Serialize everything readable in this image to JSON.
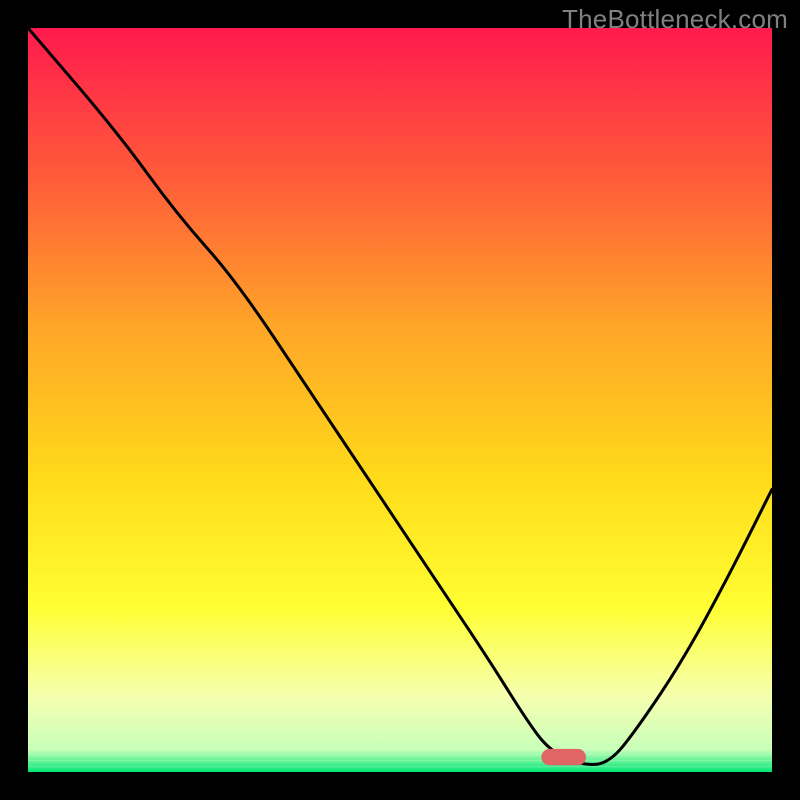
{
  "watermark": "TheBottleneck.com",
  "chart_data": {
    "type": "line",
    "title": "",
    "xlabel": "",
    "ylabel": "",
    "xlim": [
      0,
      100
    ],
    "ylim": [
      0,
      100
    ],
    "grid": false,
    "legend": false,
    "background": {
      "type": "vertical-gradient",
      "stops": [
        {
          "pos": 0.0,
          "color": "#ff1a4d"
        },
        {
          "pos": 0.2,
          "color": "#ff5b3a"
        },
        {
          "pos": 0.4,
          "color": "#ffa528"
        },
        {
          "pos": 0.6,
          "color": "#ffd91a"
        },
        {
          "pos": 0.78,
          "color": "#ffff33"
        },
        {
          "pos": 0.9,
          "color": "#f5ffb0"
        },
        {
          "pos": 0.97,
          "color": "#c7ffb8"
        },
        {
          "pos": 1.0,
          "color": "#00e676"
        }
      ]
    },
    "series": [
      {
        "name": "bottleneck-curve",
        "type": "line",
        "color": "#000000",
        "width": 3,
        "x": [
          0,
          12,
          20,
          28,
          38,
          48,
          56,
          62,
          67,
          70,
          74,
          78,
          82,
          88,
          94,
          100
        ],
        "values": [
          100,
          86,
          75,
          66,
          51,
          36,
          24,
          15,
          7,
          3,
          1,
          1,
          6,
          15,
          26,
          38
        ]
      }
    ],
    "marker": {
      "name": "optimal-point",
      "shape": "rounded-rect",
      "color": "#e06666",
      "x": 72,
      "y": 2,
      "w": 6,
      "h": 2.2
    },
    "axes": {
      "color": "#000000",
      "width": 28,
      "ticks": false
    }
  }
}
